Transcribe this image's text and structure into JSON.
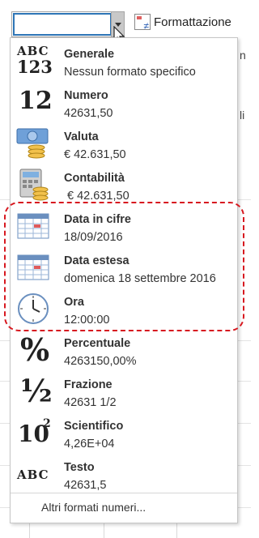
{
  "ribbon": {
    "format_label": "Formattazione"
  },
  "combo": {
    "value": ""
  },
  "formats": [
    {
      "name": "Generale",
      "example": "Nessun formato specifico",
      "icon": "abc-123-icon"
    },
    {
      "name": "Numero",
      "example": "42631,50",
      "icon": "number-12-icon"
    },
    {
      "name": "Valuta",
      "example": "€ 42.631,50",
      "icon": "currency-icon"
    },
    {
      "name": "Contabilità",
      "example": " € 42.631,50",
      "icon": "accounting-icon"
    },
    {
      "name": "Data in cifre",
      "example": "18/09/2016",
      "icon": "calendar-icon"
    },
    {
      "name": "Data estesa",
      "example": "domenica 18 settembre 2016",
      "icon": "calendar-icon"
    },
    {
      "name": "Ora",
      "example": "12:00:00",
      "icon": "clock-icon"
    },
    {
      "name": "Percentuale",
      "example": "4263150,00%",
      "icon": "percent-icon"
    },
    {
      "name": "Frazione",
      "example": "42631 1/2",
      "icon": "fraction-icon"
    },
    {
      "name": "Scientifico",
      "example": "4,26E+04",
      "icon": "scientific-icon"
    },
    {
      "name": "Testo",
      "example": "42631,5",
      "icon": "text-abc-icon"
    }
  ],
  "more_formats": "Altri formati numeri...",
  "side_fragments": [
    "n",
    "li"
  ],
  "highlight_color": "#d71920",
  "accent": "#2e75b6"
}
